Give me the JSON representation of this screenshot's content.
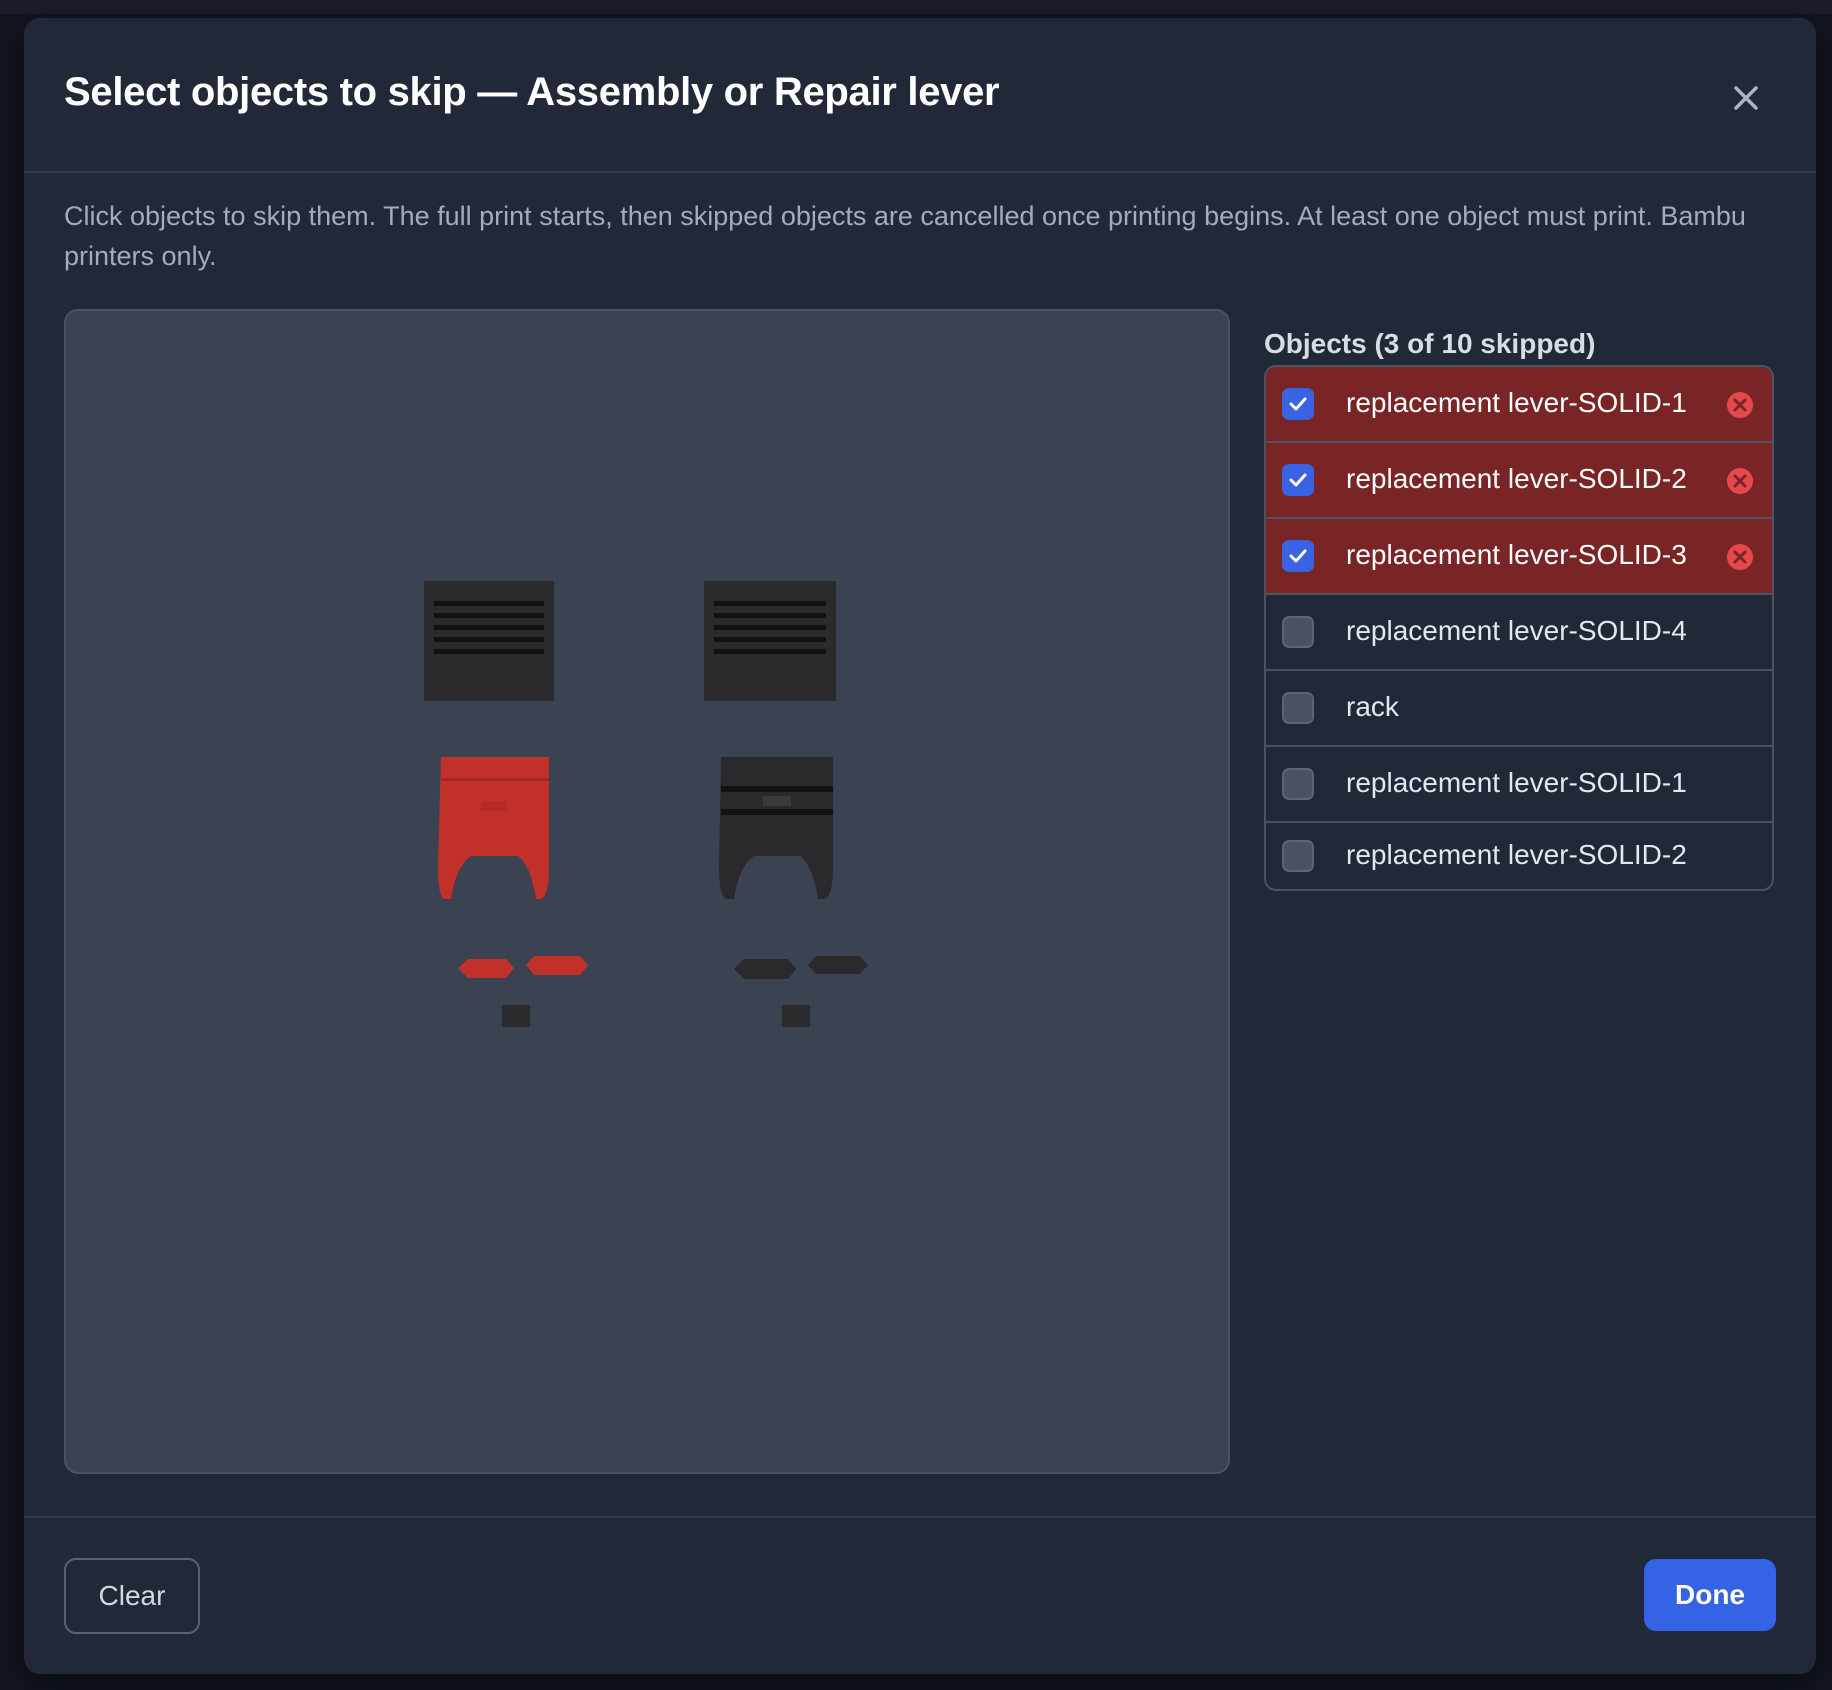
{
  "dialog": {
    "title": "Select objects to skip — Assembly or Repair lever",
    "description": "Click objects to skip them. The full print starts, then skipped objects are cancelled once printing begins. At least one object must print. Bambu printers only.",
    "close_icon": "close-icon"
  },
  "objects": {
    "heading": "Objects (3 of 10 skipped)",
    "items": [
      {
        "name": "replacement lever-SOLID-1",
        "skipped": true
      },
      {
        "name": "replacement lever-SOLID-2",
        "skipped": true
      },
      {
        "name": "replacement lever-SOLID-3",
        "skipped": true
      },
      {
        "name": "replacement lever-SOLID-4",
        "skipped": false
      },
      {
        "name": "rack",
        "skipped": false
      },
      {
        "name": "replacement lever-SOLID-1",
        "skipped": false
      },
      {
        "name": "replacement lever-SOLID-2",
        "skipped": false
      }
    ]
  },
  "footer": {
    "clear_label": "Clear",
    "done_label": "Done"
  },
  "colors": {
    "accent": "#3563e6",
    "skipped_row": "#7a2525",
    "skipped_object": "#c2302a",
    "normal_object": "#2a2a2c",
    "remove_icon": "#e5484d"
  }
}
